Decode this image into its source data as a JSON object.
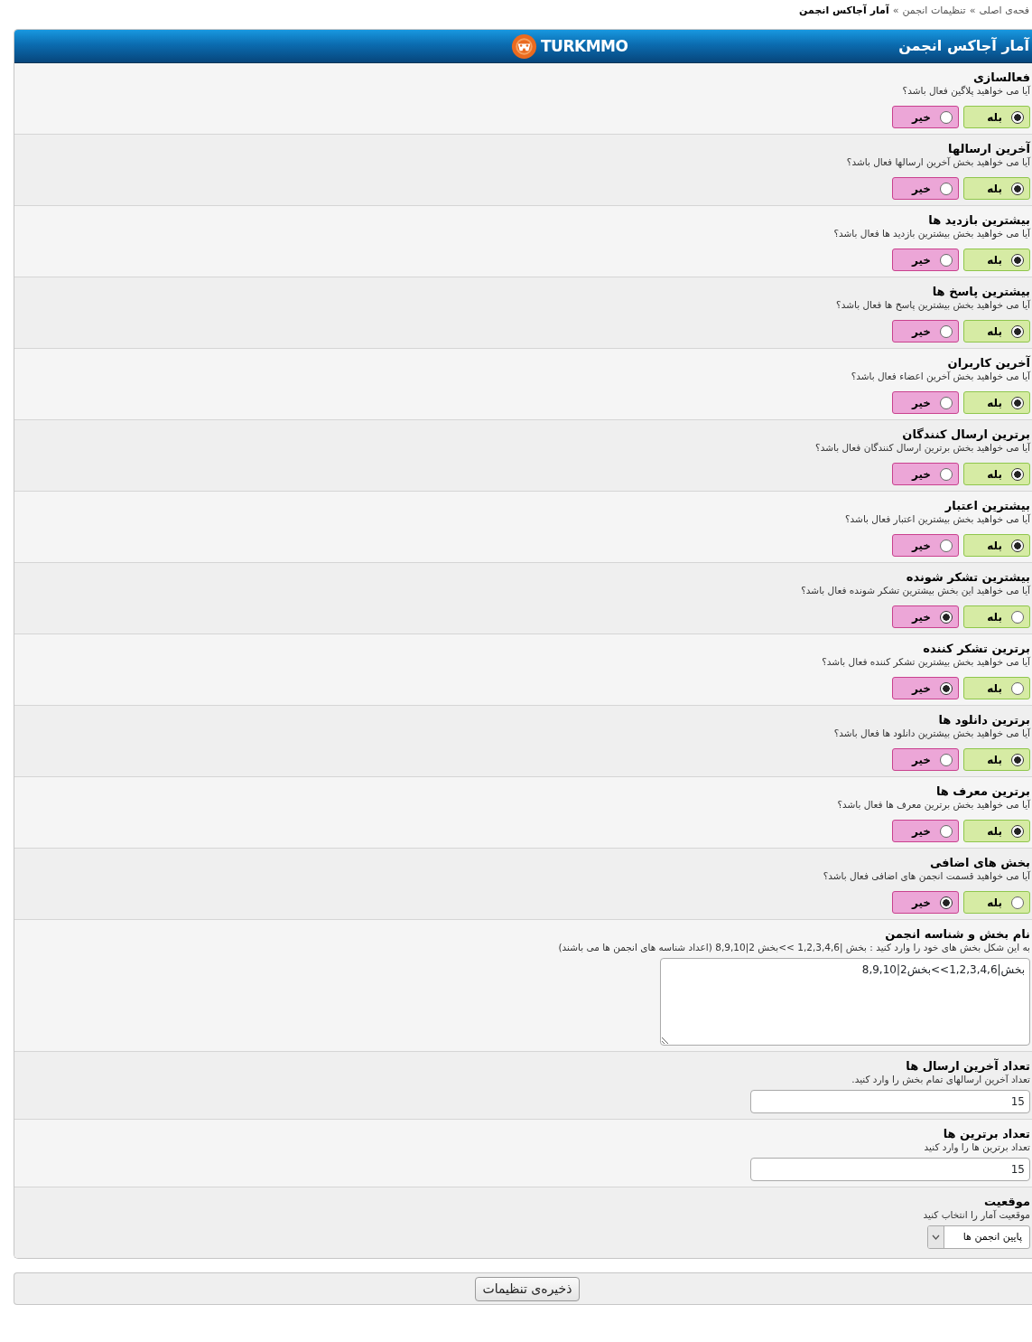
{
  "breadcrumb": [
    {
      "kind": "link",
      "label": "فحه‌ی اصلی"
    },
    {
      "kind": "separator",
      "label": "»"
    },
    {
      "kind": "link",
      "label": "تنظیمات انجمن"
    },
    {
      "kind": "separator",
      "label": "»"
    },
    {
      "kind": "current",
      "label": "آمار آجاکس انجمن"
    }
  ],
  "panel": {
    "title": "آمار آجاکس انجمن",
    "logo_text": "TURKMMO"
  },
  "settings": [
    {
      "kind": "radio",
      "title": "فعالسازی",
      "description": "آیا می خواهید پلاگین فعال باشد؟",
      "options": [
        {
          "kind": "yes",
          "label": "بله",
          "selected": true
        },
        {
          "kind": "no",
          "label": "خیر",
          "selected": false
        }
      ]
    },
    {
      "kind": "radio",
      "title": "آخرین ارسالها",
      "description": "آیا می خواهید بخش آخرین ارسالها فعال باشد؟",
      "options": [
        {
          "kind": "yes",
          "label": "بله",
          "selected": true
        },
        {
          "kind": "no",
          "label": "خیر",
          "selected": false
        }
      ]
    },
    {
      "kind": "radio",
      "title": "بیشترین بازدید ها",
      "description": "آیا می خواهید بخش بیشترین بازدید ها فعال باشد؟",
      "options": [
        {
          "kind": "yes",
          "label": "بله",
          "selected": true
        },
        {
          "kind": "no",
          "label": "خیر",
          "selected": false
        }
      ]
    },
    {
      "kind": "radio",
      "title": "بیشترین پاسخ ها",
      "description": "آیا می خواهید بخش بیشترین پاسخ ها فعال باشد؟",
      "options": [
        {
          "kind": "yes",
          "label": "بله",
          "selected": true
        },
        {
          "kind": "no",
          "label": "خیر",
          "selected": false
        }
      ]
    },
    {
      "kind": "radio",
      "title": "آخرین کاربران",
      "description": "آیا می خواهید بخش آخرین اعضاء فعال باشد؟",
      "options": [
        {
          "kind": "yes",
          "label": "بله",
          "selected": true
        },
        {
          "kind": "no",
          "label": "خیر",
          "selected": false
        }
      ]
    },
    {
      "kind": "radio",
      "title": "برترین ارسال کنندگان",
      "description": "آیا می خواهید بخش برترین ارسال کنندگان فعال باشد؟",
      "options": [
        {
          "kind": "yes",
          "label": "بله",
          "selected": true
        },
        {
          "kind": "no",
          "label": "خیر",
          "selected": false
        }
      ]
    },
    {
      "kind": "radio",
      "title": "بیشترین اعتبار",
      "description": "آیا می خواهید بخش بیشترین اعتبار فعال باشد؟",
      "options": [
        {
          "kind": "yes",
          "label": "بله",
          "selected": true
        },
        {
          "kind": "no",
          "label": "خیر",
          "selected": false
        }
      ]
    },
    {
      "kind": "radio",
      "title": "بیشترین تشکر شونده",
      "description": "آیا می خواهید این بخش بیشترین تشکر شونده فعال باشد؟",
      "options": [
        {
          "kind": "yes",
          "label": "بله",
          "selected": false
        },
        {
          "kind": "no",
          "label": "خیر",
          "selected": true
        }
      ]
    },
    {
      "kind": "radio",
      "title": "برترین تشکر کننده",
      "description": "آیا می خواهید بخش بیشترین تشکر کننده فعال باشد؟",
      "options": [
        {
          "kind": "yes",
          "label": "بله",
          "selected": false
        },
        {
          "kind": "no",
          "label": "خیر",
          "selected": true
        }
      ]
    },
    {
      "kind": "radio",
      "title": "برترین دانلود ها",
      "description": "آیا می خواهید بخش بیشترین دانلود ها فعال باشد؟",
      "options": [
        {
          "kind": "yes",
          "label": "بله",
          "selected": true
        },
        {
          "kind": "no",
          "label": "خیر",
          "selected": false
        }
      ]
    },
    {
      "kind": "radio",
      "title": "برترین معرف ها",
      "description": "آیا می خواهید بخش برترین معرف ها فعال باشد؟",
      "options": [
        {
          "kind": "yes",
          "label": "بله",
          "selected": true
        },
        {
          "kind": "no",
          "label": "خیر",
          "selected": false
        }
      ]
    },
    {
      "kind": "radio",
      "title": "بخش های اضافی",
      "description": "آیا می خواهید قسمت انجمن های اضافی فعال باشد؟",
      "options": [
        {
          "kind": "yes",
          "label": "بله",
          "selected": false
        },
        {
          "kind": "no",
          "label": "خیر",
          "selected": true
        }
      ]
    },
    {
      "kind": "textarea",
      "title": "نام بخش و شناسه انجمن",
      "description": "به این شکل بخش های خود را وارد کنید : بخش |1,2,3,4,6 >>بخش 2|8,9,10 (اعداد شناسه های انجمن ها می باشند)",
      "value": "بخش|1,2,3,4,6>>بخش2|8,9,10"
    },
    {
      "kind": "text",
      "title": "تعداد آخرین ارسال ها",
      "description": "تعداد آخرین ارسالهای تمام بخش را وارد کنید.",
      "value": "15"
    },
    {
      "kind": "text",
      "title": "تعداد برترین ها",
      "description": "تعداد برترین ها را وارد کنید",
      "value": "15"
    },
    {
      "kind": "select",
      "title": "موقعیت",
      "description": "موقعیت آمار را انتخاب کنید",
      "value": "پایین انجمن ها"
    }
  ],
  "save_button": "ذخیره‌ی تنظیمات"
}
